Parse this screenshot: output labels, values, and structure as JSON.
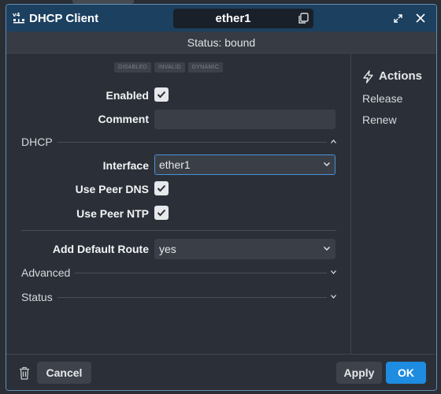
{
  "window": {
    "app_title": "DHCP Client",
    "object_name": "ether1",
    "status_text": "Status: bound",
    "accent_color": "#1c4060",
    "primary_color": "#1e8ce0"
  },
  "flags": [
    "DISABLED",
    "INVALID",
    "DYNAMIC"
  ],
  "form": {
    "enabled": {
      "label": "Enabled",
      "checked": true
    },
    "comment": {
      "label": "Comment",
      "value": ""
    },
    "dhcp_section": "DHCP",
    "interface": {
      "label": "Interface",
      "value": "ether1"
    },
    "use_peer_dns": {
      "label": "Use Peer DNS",
      "checked": true
    },
    "use_peer_ntp": {
      "label": "Use Peer NTP",
      "checked": true
    },
    "add_default_route": {
      "label": "Add Default Route",
      "value": "yes"
    },
    "advanced_section": "Advanced",
    "status_section": "Status"
  },
  "actions": {
    "title": "Actions",
    "items": [
      "Release",
      "Renew"
    ]
  },
  "footer": {
    "cancel": "Cancel",
    "apply": "Apply",
    "ok": "OK"
  },
  "icons": {
    "app": "dhcp-v4-icon",
    "copy": "copy-icon",
    "expand": "expand-icon",
    "close": "close-icon",
    "actions": "lightning-icon",
    "delete": "trash-icon"
  }
}
